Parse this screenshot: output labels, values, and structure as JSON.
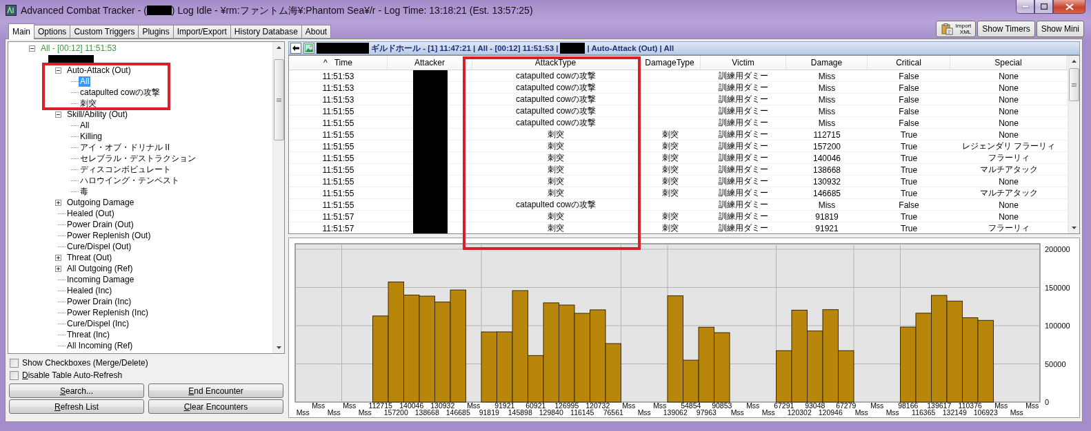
{
  "window": {
    "title_start": "Advanced Combat Tracker - (",
    "title_end": ") Log Idle - ¥rm:ファントム海¥:Phantom Sea¥/r - Log Time: 13:18:21 (Est. 13:57:25)"
  },
  "tabs": [
    {
      "label": "Main",
      "selected": true
    },
    {
      "label": "Options",
      "selected": false
    },
    {
      "label": "Custom Triggers",
      "selected": false
    },
    {
      "label": "Plugins",
      "selected": false
    },
    {
      "label": "Import/Export",
      "selected": false
    },
    {
      "label": "History Database",
      "selected": false
    },
    {
      "label": "About",
      "selected": false
    }
  ],
  "toolbar_buttons": [
    {
      "kind": "import",
      "lines": [
        "Import",
        "XML"
      ]
    },
    {
      "kind": "text",
      "label": "Show Timers"
    },
    {
      "kind": "text",
      "label": "Show Mini"
    }
  ],
  "tree": [
    {
      "label": "All - [00:12] 11:51:53",
      "kind": "encounter",
      "expanded": true,
      "selected": false,
      "children": [
        {
          "kind": "redacted",
          "selected": false,
          "children": [
            {
              "label": "Auto-Attack (Out)",
              "expanded": true,
              "selected": false,
              "children": [
                {
                  "label": "All",
                  "selected": true
                },
                {
                  "label": "catapulted cowの攻撃",
                  "selected": false
                },
                {
                  "label": "刺突",
                  "selected": false
                }
              ]
            },
            {
              "label": "Skill/Ability (Out)",
              "expanded": true,
              "selected": false,
              "children": [
                {
                  "label": "All",
                  "selected": false
                },
                {
                  "label": "Killing",
                  "selected": false
                },
                {
                  "label": "アイ・オブ・ドリナル II",
                  "selected": false
                },
                {
                  "label": "セレブラル・デストラクション",
                  "selected": false
                },
                {
                  "label": "ディスコンボビュレート",
                  "selected": false
                },
                {
                  "label": "ハロウイング・テンペスト",
                  "selected": false
                },
                {
                  "label": "毒",
                  "selected": false
                }
              ]
            },
            {
              "label": "Outgoing Damage",
              "expanded": false,
              "selected": false
            },
            {
              "label": "Healed (Out)",
              "selected": false
            },
            {
              "label": "Power Drain (Out)",
              "selected": false
            },
            {
              "label": "Power Replenish (Out)",
              "selected": false
            },
            {
              "label": "Cure/Dispel (Out)",
              "selected": false
            },
            {
              "label": "Threat (Out)",
              "expanded": false,
              "selected": false
            },
            {
              "label": "All Outgoing (Ref)",
              "expanded": false,
              "selected": false
            },
            {
              "label": "Incoming Damage",
              "selected": false
            },
            {
              "label": "Healed (Inc)",
              "selected": false
            },
            {
              "label": "Power Drain (Inc)",
              "selected": false
            },
            {
              "label": "Power Replenish (Inc)",
              "selected": false
            },
            {
              "label": "Cure/Dispel (Inc)",
              "selected": false
            },
            {
              "label": "Threat (Inc)",
              "selected": false
            },
            {
              "label": "All Incoming (Ref)",
              "selected": false
            }
          ]
        }
      ]
    }
  ],
  "options": [
    {
      "text": "Show Checkboxes (Merge/Delete)",
      "checked": false
    },
    {
      "key": "D",
      "text": "isable Table Auto-Refresh",
      "checked": false
    }
  ],
  "buttons": [
    {
      "key": "S",
      "text": "earch..."
    },
    {
      "key": "E",
      "text": "nd Encounter"
    },
    {
      "key": "R",
      "text": "efresh List"
    },
    {
      "key": "C",
      "text": "lear Encounters"
    }
  ],
  "breadcrumb": [
    {
      "kind": "redacted"
    },
    {
      "kind": "text",
      "text": "ギルドホール - [1] 11:47:21 | All - [00:12] 11:51:53 |"
    },
    {
      "kind": "redacted"
    },
    {
      "kind": "text",
      "text": "| Auto-Attack (Out) | All"
    }
  ],
  "table": {
    "columns": [
      {
        "label": "Time",
        "sort": "^"
      },
      {
        "label": "Attacker"
      },
      {
        "label": "AttackType"
      },
      {
        "label": "DamageType"
      },
      {
        "label": "Victim"
      },
      {
        "label": "Damage"
      },
      {
        "label": "Critical"
      },
      {
        "label": "Special"
      }
    ],
    "rows": [
      {
        "time": "11:51:53",
        "attack_type": "catapulted cowの攻撃",
        "victim": "訓練用ダミー",
        "damage": "Miss",
        "critical": "False",
        "special": "None"
      },
      {
        "time": "11:51:53",
        "attack_type": "catapulted cowの攻撃",
        "victim": "訓練用ダミー",
        "damage": "Miss",
        "critical": "False",
        "special": "None"
      },
      {
        "time": "11:51:53",
        "attack_type": "catapulted cowの攻撃",
        "victim": "訓練用ダミー",
        "damage": "Miss",
        "critical": "False",
        "special": "None"
      },
      {
        "time": "11:51:55",
        "attack_type": "catapulted cowの攻撃",
        "victim": "訓練用ダミー",
        "damage": "Miss",
        "critical": "False",
        "special": "None"
      },
      {
        "time": "11:51:55",
        "attack_type": "catapulted cowの攻撃",
        "victim": "訓練用ダミー",
        "damage": "Miss",
        "critical": "False",
        "special": "None"
      },
      {
        "time": "11:51:55",
        "attack_type": "刺突",
        "damage_type": "刺突",
        "victim": "訓練用ダミー",
        "damage": "112715",
        "critical": "True",
        "special": "None"
      },
      {
        "time": "11:51:55",
        "attack_type": "刺突",
        "damage_type": "刺突",
        "victim": "訓練用ダミー",
        "damage": "157200",
        "critical": "True",
        "special": "レジェンダリ フラーリィ"
      },
      {
        "time": "11:51:55",
        "attack_type": "刺突",
        "damage_type": "刺突",
        "victim": "訓練用ダミー",
        "damage": "140046",
        "critical": "True",
        "special": "フラーリィ"
      },
      {
        "time": "11:51:55",
        "attack_type": "刺突",
        "damage_type": "刺突",
        "victim": "訓練用ダミー",
        "damage": "138668",
        "critical": "True",
        "special": "マルチアタック"
      },
      {
        "time": "11:51:55",
        "attack_type": "刺突",
        "damage_type": "刺突",
        "victim": "訓練用ダミー",
        "damage": "130932",
        "critical": "True",
        "special": "None"
      },
      {
        "time": "11:51:55",
        "attack_type": "刺突",
        "damage_type": "刺突",
        "victim": "訓練用ダミー",
        "damage": "146685",
        "critical": "True",
        "special": "マルチアタック"
      },
      {
        "time": "11:51:55",
        "attack_type": "catapulted cowの攻撃",
        "victim": "訓練用ダミー",
        "damage": "Miss",
        "critical": "False",
        "special": "None"
      },
      {
        "time": "11:51:57",
        "attack_type": "刺突",
        "damage_type": "刺突",
        "victim": "訓練用ダミー",
        "damage": "91819",
        "critical": "True",
        "special": "None"
      },
      {
        "time": "11:51:57",
        "attack_type": "刺突",
        "damage_type": "刺突",
        "victim": "訓練用ダミー",
        "damage": "91921",
        "critical": "True",
        "special": "フラーリィ"
      }
    ]
  },
  "chart": {
    "chart_data": {
      "type": "bar",
      "categories": [
        "Mss",
        "Mss",
        "Mss",
        "Mss",
        "Mss",
        "112715",
        "157200",
        "140046",
        "138668",
        "130932",
        "146685",
        "Mss",
        "91819",
        "91921",
        "145898",
        "60921",
        "129840",
        "126995",
        "116145",
        "120732",
        "76561",
        "Mss",
        "Mss",
        "Mss",
        "139062",
        "54854",
        "97963",
        "90853",
        "Mss",
        "Mss",
        "Mss",
        "67291",
        "120302",
        "93048",
        "120946",
        "67279",
        "Mss",
        "Mss",
        "Mss",
        "98166",
        "116365",
        "139617",
        "132149",
        "110376",
        "106923",
        "Mss",
        "Mss",
        "Mss"
      ],
      "series": [
        {
          "color": "#b8860b",
          "values": [
            null,
            null,
            null,
            null,
            null,
            112715,
            157200,
            140046,
            138668,
            130932,
            146685,
            null,
            91819,
            91921,
            145898,
            60921,
            129840,
            126995,
            116145,
            120732,
            76561,
            null,
            null,
            null,
            139062,
            54854,
            97963,
            90853,
            null,
            null,
            null,
            67291,
            120302,
            93048,
            120946,
            67279,
            null,
            null,
            null,
            98166,
            116365,
            139617,
            132149,
            110376,
            106923,
            null,
            null,
            null
          ]
        }
      ],
      "ylim": [
        0,
        200000
      ],
      "yticks": [
        0,
        50000,
        100000,
        150000,
        200000
      ],
      "grid": true
    }
  },
  "annotations": [
    {
      "kind": "frame"
    },
    {
      "kind": "frame"
    }
  ]
}
